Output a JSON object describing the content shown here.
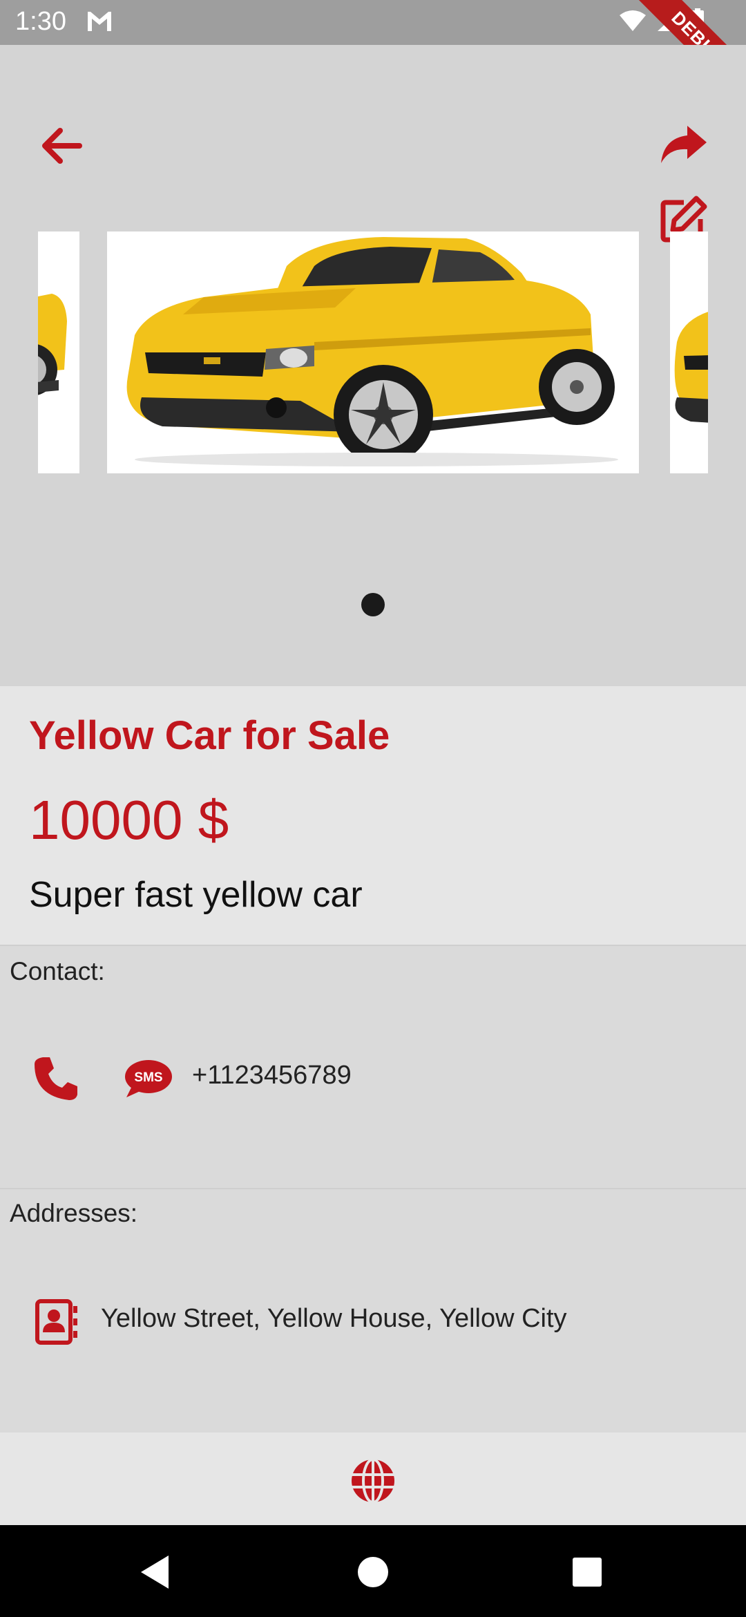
{
  "status_bar": {
    "time": "1:30",
    "debug_label": "DEBUG"
  },
  "colors": {
    "accent": "#c0161d",
    "background": "#dadada",
    "car": "#f2c21a"
  },
  "header": {
    "back_icon": "arrow-left-icon",
    "share_icon": "share-icon",
    "edit_icon": "edit-icon"
  },
  "gallery": {
    "image_count": 1,
    "current_index": 0,
    "image": "yellow-car"
  },
  "listing": {
    "title": "Yellow Car for Sale",
    "price": "10000 $",
    "description": "Super fast yellow car"
  },
  "contact": {
    "label": "Contact:",
    "phone": "+1123456789",
    "call_icon": "phone-icon",
    "sms_icon": "sms-icon"
  },
  "addresses": {
    "label": "Addresses:",
    "items": [
      {
        "text": "Yellow Street, Yellow House, Yellow City"
      }
    ]
  },
  "footer": {
    "globe_icon": "globe-icon"
  }
}
